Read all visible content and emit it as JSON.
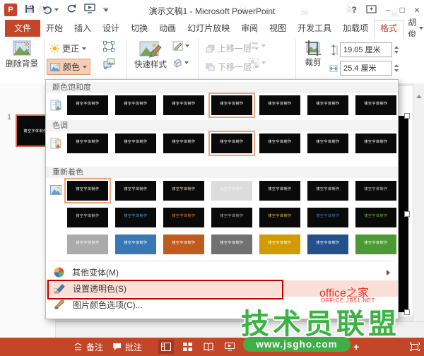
{
  "window": {
    "title": "演示文稿1 - Microsoft PowerPoint",
    "qat_icons": [
      "powerpoint-logo",
      "save",
      "undo",
      "redo",
      "start-slideshow",
      "customize-quick-access"
    ],
    "control_icons": [
      "help",
      "ribbon-display-options",
      "minimize",
      "maximize",
      "close"
    ],
    "logo_letter": "P",
    "help_glyph": "?",
    "minimize_glyph": "–",
    "maximize_glyph": "□",
    "close_glyph": "×"
  },
  "tabs": [
    {
      "id": "file",
      "label": "文件",
      "file": true
    },
    {
      "id": "home",
      "label": "开始"
    },
    {
      "id": "insert",
      "label": "插入"
    },
    {
      "id": "design",
      "label": "设计"
    },
    {
      "id": "transitions",
      "label": "切换"
    },
    {
      "id": "animations",
      "label": "动画"
    },
    {
      "id": "slideshow",
      "label": "幻灯片放映"
    },
    {
      "id": "review",
      "label": "审阅"
    },
    {
      "id": "view",
      "label": "视图"
    },
    {
      "id": "developer",
      "label": "开发工具"
    },
    {
      "id": "addins",
      "label": "加载项"
    },
    {
      "id": "format",
      "label": "格式",
      "active": true
    }
  ],
  "user": {
    "name": "胡俊"
  },
  "ribbon": {
    "remove_background": "删除背景",
    "corrections": "更正",
    "color": "颜色",
    "quick_styles": "快速样式",
    "bring_forward": "上移一层",
    "send_backward": "下移一层",
    "crop": "裁剪",
    "height_value": "19.05 厘米",
    "width_value": "25.4 厘米"
  },
  "slide_panel": {
    "slide_number": "1"
  },
  "gallery_text": "镂空字体制作",
  "dropdown": {
    "sections": [
      {
        "title": "颜色饱和度",
        "rows": [
          [
            {
              "bg": "#0A0A0A",
              "fg": "#FFFFFF"
            },
            {
              "bg": "#0A0A0A",
              "fg": "#FFFFFF"
            },
            {
              "bg": "#0A0A0A",
              "fg": "#FFFFFF"
            },
            {
              "bg": "#0A0A0A",
              "fg": "#FFFFFF",
              "sel": true
            },
            {
              "bg": "#0A0A0A",
              "fg": "#FFFFFF"
            },
            {
              "bg": "#0A0A0A",
              "fg": "#FFFFFF"
            },
            {
              "bg": "#0A0A0A",
              "fg": "#FFFFFF"
            }
          ]
        ]
      },
      {
        "title": "色调",
        "rows": [
          [
            {
              "bg": "#0A0A0A",
              "fg": "#FFFFFF"
            },
            {
              "bg": "#0A0A0A",
              "fg": "#FFFFFF"
            },
            {
              "bg": "#0A0A0A",
              "fg": "#FFFFFF"
            },
            {
              "bg": "#0A0A0A",
              "fg": "#FFFFFF",
              "sel": true
            },
            {
              "bg": "#0A0A0A",
              "fg": "#FFFFFF"
            },
            {
              "bg": "#0A0A0A",
              "fg": "#FFFFFF"
            },
            {
              "bg": "#0A0A0A",
              "fg": "#FFFFFF"
            }
          ]
        ]
      },
      {
        "title": "重新着色",
        "rows": [
          [
            {
              "bg": "#0A0A0A",
              "fg": "#FFFFFF",
              "sel": true
            },
            {
              "bg": "#0A0A0A",
              "fg": "#F2F2F2"
            },
            {
              "bg": "#0A0A0A",
              "fg": "#EDE0CE"
            },
            {
              "bg": "#DCDCDC",
              "fg": "#F4F4F4"
            },
            {
              "bg": "#0A0A0A",
              "fg": "#F5F5F5"
            },
            {
              "bg": "#0A0A0A",
              "fg": "#EAEAEA"
            },
            {
              "bg": "#0A0A0A",
              "fg": "#CFCFCF"
            }
          ],
          [
            {
              "bg": "#0A0A0A",
              "fg": "#D9D9D9"
            },
            {
              "bg": "#0A0A0A",
              "fg": "#5B9BD5"
            },
            {
              "bg": "#0A0A0A",
              "fg": "#ED7D31"
            },
            {
              "bg": "#0A0A0A",
              "fg": "#B5B5B5"
            },
            {
              "bg": "#0A0A0A",
              "fg": "#E7C13D"
            },
            {
              "bg": "#0A0A0A",
              "fg": "#4472C4"
            },
            {
              "bg": "#0A0A0A",
              "fg": "#70AD47"
            }
          ],
          [
            {
              "bg": "#ABABAB",
              "fg": "#FFFFFF"
            },
            {
              "bg": "#3878B4",
              "fg": "#FFFFFF"
            },
            {
              "bg": "#C05A1E",
              "fg": "#FFFFFF"
            },
            {
              "bg": "#717171",
              "fg": "#FFFFFF"
            },
            {
              "bg": "#D29C00",
              "fg": "#FFFFFF"
            },
            {
              "bg": "#24508C",
              "fg": "#FFFFFF"
            },
            {
              "bg": "#4C9A33",
              "fg": "#FFFFFF"
            }
          ]
        ]
      }
    ],
    "items": [
      {
        "label": "其他变体(M)"
      },
      {
        "label": "设置透明色(S)"
      },
      {
        "label": "图片颜色选项(C)..."
      }
    ]
  },
  "statusbar": {
    "notes": "备注",
    "comments": "批注",
    "view_icons": [
      "normal-view",
      "slide-sorter",
      "reading-view",
      "slideshow-view"
    ],
    "zoom_plus": "+"
  },
  "watermarks": {
    "brand": "office之家",
    "brand_sub": "OFFICE.JB51.NET",
    "site": "技术员联盟",
    "url": "www.jsgho.com"
  },
  "accent_colors": {
    "titlebar_red": "#C34628",
    "highlight_pink": "#F9DFD6",
    "selection_orange": "#F0A27C",
    "annotation_red": "#C00000",
    "watermark_green": "#3FAE47",
    "watermark_red": "#E23B2E"
  }
}
